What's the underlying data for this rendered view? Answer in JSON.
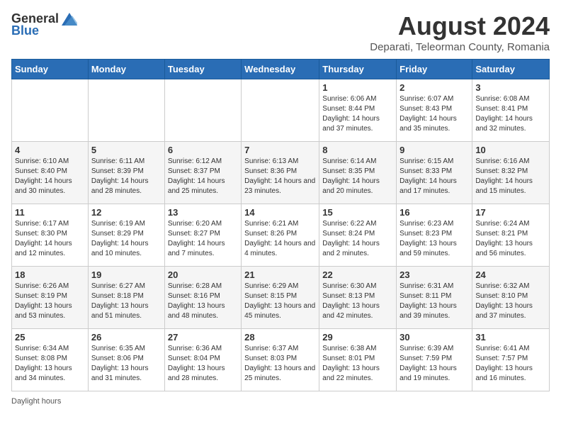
{
  "header": {
    "logo_general": "General",
    "logo_blue": "Blue",
    "month_year": "August 2024",
    "location": "Deparati, Teleorman County, Romania"
  },
  "days_of_week": [
    "Sunday",
    "Monday",
    "Tuesday",
    "Wednesday",
    "Thursday",
    "Friday",
    "Saturday"
  ],
  "weeks": [
    [
      {
        "day": "",
        "info": ""
      },
      {
        "day": "",
        "info": ""
      },
      {
        "day": "",
        "info": ""
      },
      {
        "day": "",
        "info": ""
      },
      {
        "day": "1",
        "info": "Sunrise: 6:06 AM\nSunset: 8:44 PM\nDaylight: 14 hours and 37 minutes."
      },
      {
        "day": "2",
        "info": "Sunrise: 6:07 AM\nSunset: 8:43 PM\nDaylight: 14 hours and 35 minutes."
      },
      {
        "day": "3",
        "info": "Sunrise: 6:08 AM\nSunset: 8:41 PM\nDaylight: 14 hours and 32 minutes."
      }
    ],
    [
      {
        "day": "4",
        "info": "Sunrise: 6:10 AM\nSunset: 8:40 PM\nDaylight: 14 hours and 30 minutes."
      },
      {
        "day": "5",
        "info": "Sunrise: 6:11 AM\nSunset: 8:39 PM\nDaylight: 14 hours and 28 minutes."
      },
      {
        "day": "6",
        "info": "Sunrise: 6:12 AM\nSunset: 8:37 PM\nDaylight: 14 hours and 25 minutes."
      },
      {
        "day": "7",
        "info": "Sunrise: 6:13 AM\nSunset: 8:36 PM\nDaylight: 14 hours and 23 minutes."
      },
      {
        "day": "8",
        "info": "Sunrise: 6:14 AM\nSunset: 8:35 PM\nDaylight: 14 hours and 20 minutes."
      },
      {
        "day": "9",
        "info": "Sunrise: 6:15 AM\nSunset: 8:33 PM\nDaylight: 14 hours and 17 minutes."
      },
      {
        "day": "10",
        "info": "Sunrise: 6:16 AM\nSunset: 8:32 PM\nDaylight: 14 hours and 15 minutes."
      }
    ],
    [
      {
        "day": "11",
        "info": "Sunrise: 6:17 AM\nSunset: 8:30 PM\nDaylight: 14 hours and 12 minutes."
      },
      {
        "day": "12",
        "info": "Sunrise: 6:19 AM\nSunset: 8:29 PM\nDaylight: 14 hours and 10 minutes."
      },
      {
        "day": "13",
        "info": "Sunrise: 6:20 AM\nSunset: 8:27 PM\nDaylight: 14 hours and 7 minutes."
      },
      {
        "day": "14",
        "info": "Sunrise: 6:21 AM\nSunset: 8:26 PM\nDaylight: 14 hours and 4 minutes."
      },
      {
        "day": "15",
        "info": "Sunrise: 6:22 AM\nSunset: 8:24 PM\nDaylight: 14 hours and 2 minutes."
      },
      {
        "day": "16",
        "info": "Sunrise: 6:23 AM\nSunset: 8:23 PM\nDaylight: 13 hours and 59 minutes."
      },
      {
        "day": "17",
        "info": "Sunrise: 6:24 AM\nSunset: 8:21 PM\nDaylight: 13 hours and 56 minutes."
      }
    ],
    [
      {
        "day": "18",
        "info": "Sunrise: 6:26 AM\nSunset: 8:19 PM\nDaylight: 13 hours and 53 minutes."
      },
      {
        "day": "19",
        "info": "Sunrise: 6:27 AM\nSunset: 8:18 PM\nDaylight: 13 hours and 51 minutes."
      },
      {
        "day": "20",
        "info": "Sunrise: 6:28 AM\nSunset: 8:16 PM\nDaylight: 13 hours and 48 minutes."
      },
      {
        "day": "21",
        "info": "Sunrise: 6:29 AM\nSunset: 8:15 PM\nDaylight: 13 hours and 45 minutes."
      },
      {
        "day": "22",
        "info": "Sunrise: 6:30 AM\nSunset: 8:13 PM\nDaylight: 13 hours and 42 minutes."
      },
      {
        "day": "23",
        "info": "Sunrise: 6:31 AM\nSunset: 8:11 PM\nDaylight: 13 hours and 39 minutes."
      },
      {
        "day": "24",
        "info": "Sunrise: 6:32 AM\nSunset: 8:10 PM\nDaylight: 13 hours and 37 minutes."
      }
    ],
    [
      {
        "day": "25",
        "info": "Sunrise: 6:34 AM\nSunset: 8:08 PM\nDaylight: 13 hours and 34 minutes."
      },
      {
        "day": "26",
        "info": "Sunrise: 6:35 AM\nSunset: 8:06 PM\nDaylight: 13 hours and 31 minutes."
      },
      {
        "day": "27",
        "info": "Sunrise: 6:36 AM\nSunset: 8:04 PM\nDaylight: 13 hours and 28 minutes."
      },
      {
        "day": "28",
        "info": "Sunrise: 6:37 AM\nSunset: 8:03 PM\nDaylight: 13 hours and 25 minutes."
      },
      {
        "day": "29",
        "info": "Sunrise: 6:38 AM\nSunset: 8:01 PM\nDaylight: 13 hours and 22 minutes."
      },
      {
        "day": "30",
        "info": "Sunrise: 6:39 AM\nSunset: 7:59 PM\nDaylight: 13 hours and 19 minutes."
      },
      {
        "day": "31",
        "info": "Sunrise: 6:41 AM\nSunset: 7:57 PM\nDaylight: 13 hours and 16 minutes."
      }
    ]
  ],
  "footer": {
    "daylight_label": "Daylight hours"
  }
}
